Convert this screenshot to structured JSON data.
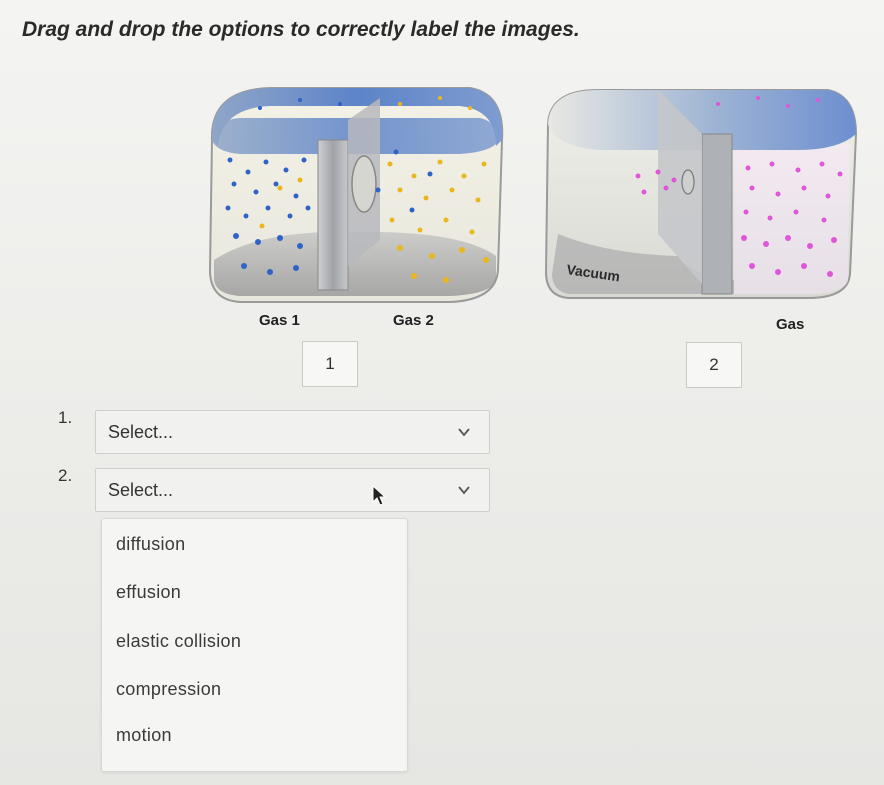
{
  "instruction": "Drag and drop the options to correctly label the images.",
  "images": {
    "left": {
      "label_gas1": "Gas 1",
      "label_gas2": "Gas 2",
      "drop_label": "1"
    },
    "right": {
      "label_vacuum": "Vacuum",
      "label_gas": "Gas",
      "drop_label": "2"
    }
  },
  "questions": [
    {
      "number": "1.",
      "select_value": "Select..."
    },
    {
      "number": "2.",
      "select_value": "Select..."
    }
  ],
  "dropdown_options": [
    "diffusion",
    "effusion",
    "elastic collision",
    "compression",
    "motion"
  ],
  "colors": {
    "blue_dot": "#2f63c8",
    "yellow_dot": "#e8b81c",
    "pink_dot": "#e056d8"
  },
  "icons": {
    "select_arrow": "chevron-down-icon",
    "cursor": "mouse-pointer-icon"
  }
}
